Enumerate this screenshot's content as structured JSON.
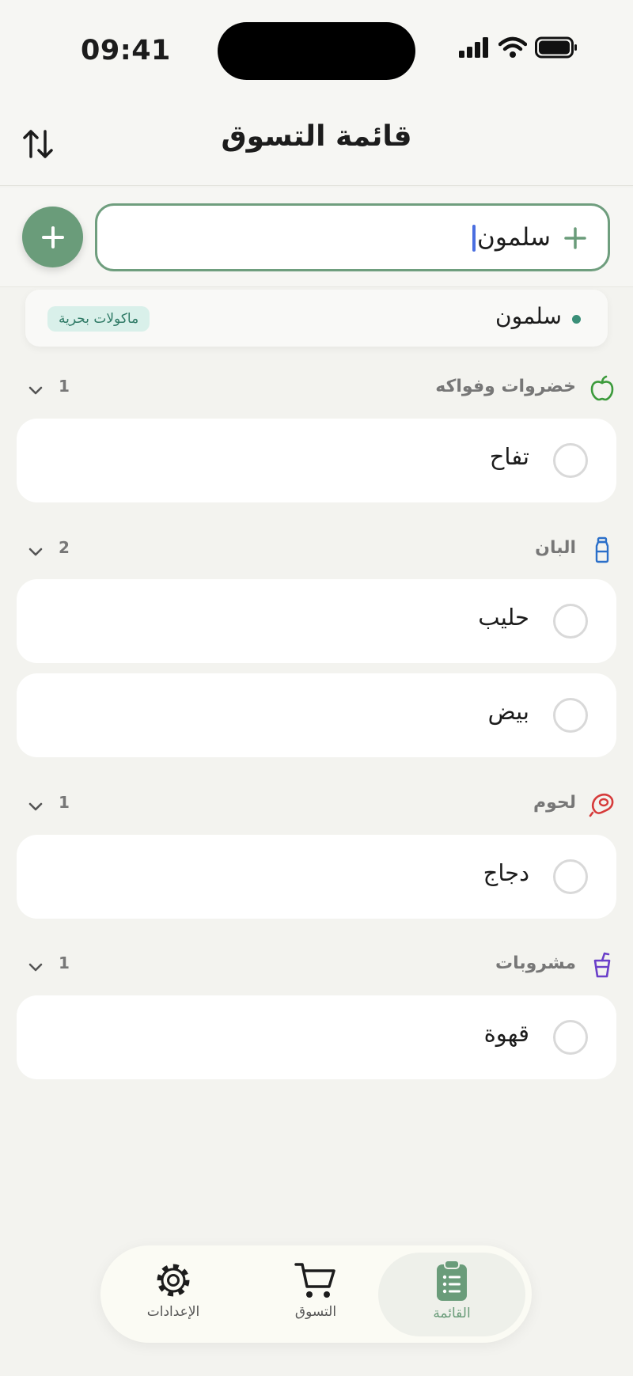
{
  "status_bar": {
    "time": "09:41"
  },
  "header": {
    "title": "قائمة التسوق"
  },
  "input": {
    "value": "سلمون"
  },
  "suggestion": {
    "name": "سلمون",
    "category": "ماكولات بحرية"
  },
  "sections": [
    {
      "title": "خضروات وفواكه",
      "count": "1",
      "icon": "apple-icon",
      "color": "#3b9a3b",
      "items": [
        {
          "label": "تفاح"
        }
      ]
    },
    {
      "title": "البان",
      "count": "2",
      "icon": "milk-bottle-icon",
      "color": "#2b6fc9",
      "items": [
        {
          "label": "حليب"
        },
        {
          "label": "بيض"
        }
      ]
    },
    {
      "title": "لحوم",
      "count": "1",
      "icon": "steak-icon",
      "color": "#d63a3a",
      "items": [
        {
          "label": "دجاج"
        }
      ]
    },
    {
      "title": "مشروبات",
      "count": "1",
      "icon": "drink-cup-icon",
      "color": "#6a3fc9",
      "items": [
        {
          "label": "قهوة"
        }
      ]
    }
  ],
  "nav": {
    "list": "القائمة",
    "shopping": "التسوق",
    "settings": "الإعدادات",
    "active_color": "#6a9c7a"
  }
}
